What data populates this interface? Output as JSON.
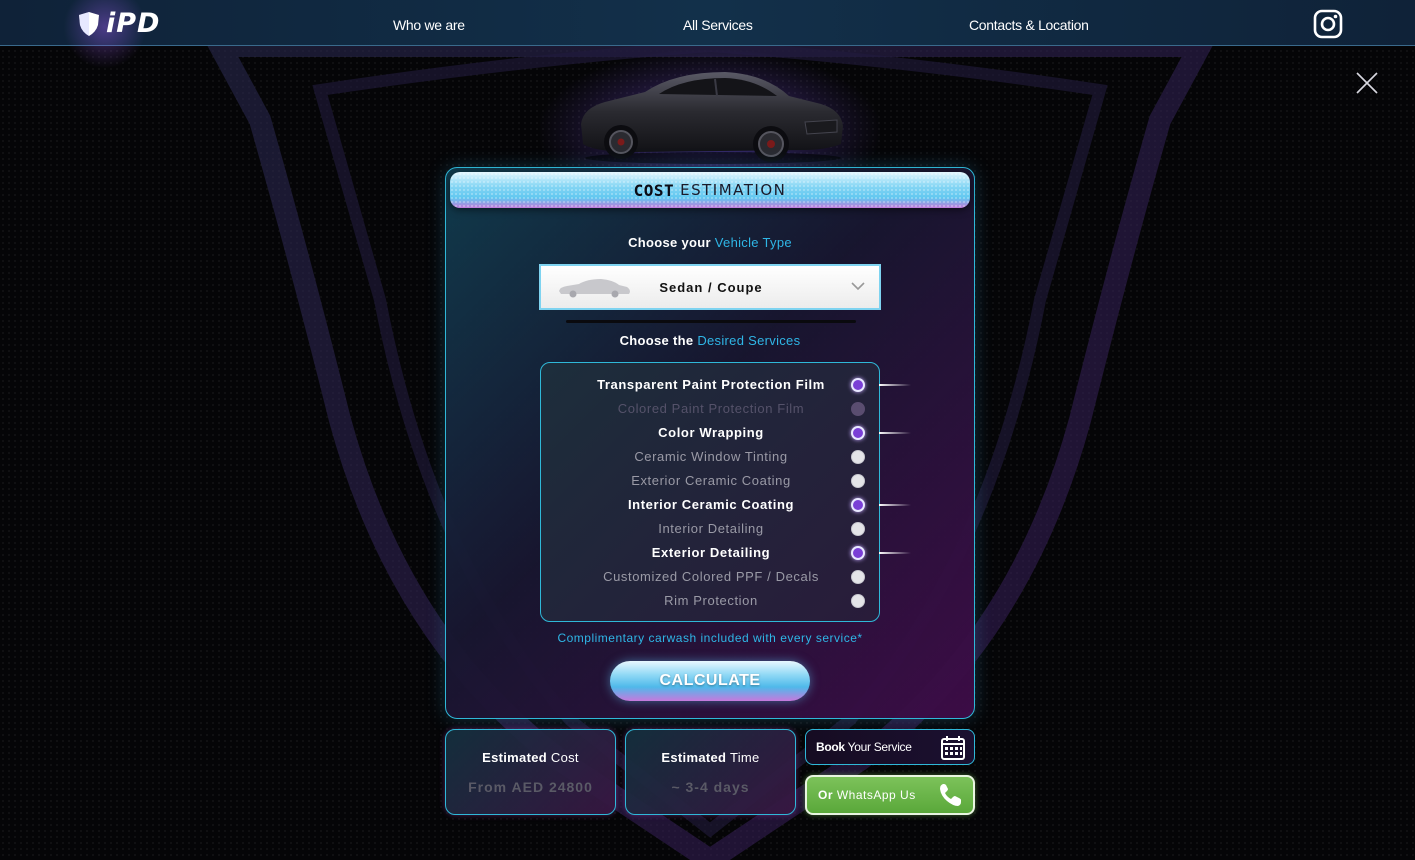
{
  "header": {
    "logo_text": "iPD",
    "nav": [
      "Who we are",
      "All Services",
      "Contacts & Location"
    ],
    "social_icon": "instagram-icon"
  },
  "modal": {
    "title_bold": "COST",
    "title_light": "ESTIMATION",
    "vehicle_label_prefix": "Choose your",
    "vehicle_label_accent": "Vehicle Type",
    "vehicle_selected": "Sedan / Coupe",
    "services_label_prefix": "Choose the",
    "services_label_accent": "Desired Services",
    "services": [
      {
        "label": "Transparent Paint Protection Film",
        "state": "selected"
      },
      {
        "label": "Colored Paint Protection Film",
        "state": "disabled"
      },
      {
        "label": "Color Wrapping",
        "state": "selected"
      },
      {
        "label": "Ceramic Window Tinting",
        "state": "unselected"
      },
      {
        "label": "Exterior Ceramic Coating",
        "state": "unselected"
      },
      {
        "label": "Interior Ceramic Coating",
        "state": "selected"
      },
      {
        "label": "Interior Detailing",
        "state": "unselected"
      },
      {
        "label": "Exterior Detailing",
        "state": "selected"
      },
      {
        "label": "Customized Colored PPF / Decals",
        "state": "unselected"
      },
      {
        "label": "Rim Protection",
        "state": "unselected"
      }
    ],
    "note": "Complimentary carwash included with every service*",
    "calculate_label": "CALCULATE"
  },
  "results": {
    "cost_title_bold": "Estimated",
    "cost_title_light": "Cost",
    "cost_value": "From AED 24800",
    "time_title_bold": "Estimated",
    "time_title_light": "Time",
    "time_value": "~ 3-4 days"
  },
  "actions": {
    "book_bold": "Book",
    "book_light": "Your Service",
    "whatsapp_bold": "Or",
    "whatsapp_light": "WhatsApp Us"
  },
  "colors": {
    "accent_cyan": "#2fb6e6",
    "accent_purple": "#7a3fd6",
    "whatsapp_green": "#5aa83a"
  }
}
